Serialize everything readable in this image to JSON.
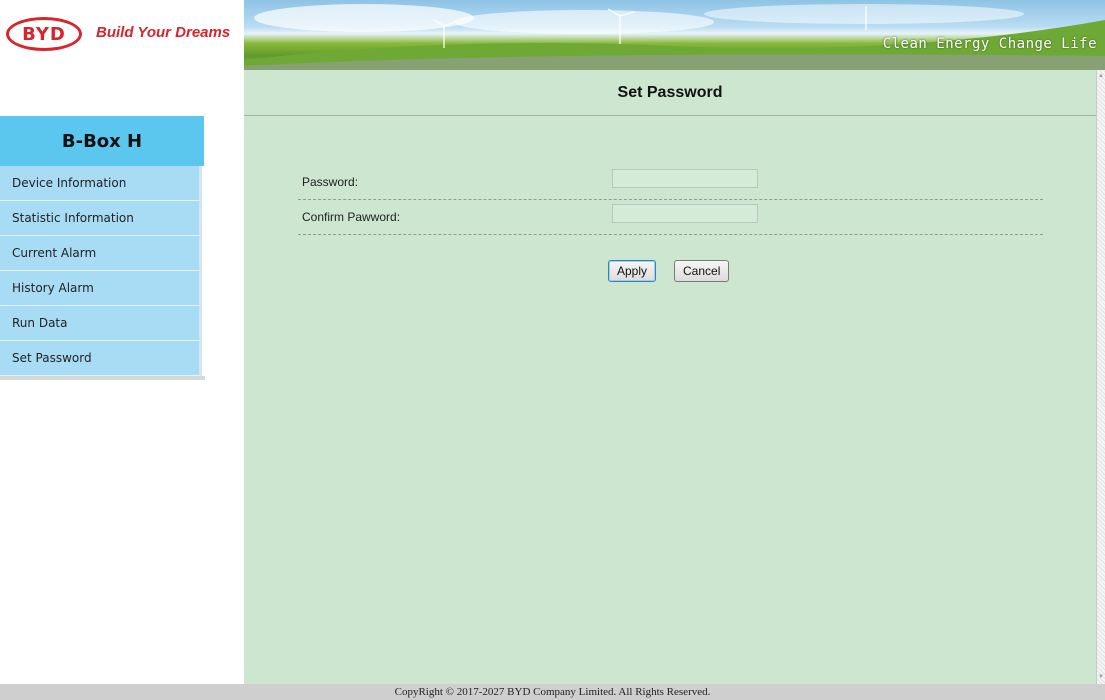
{
  "brand": {
    "logo_text": "BYD",
    "slogan": "Build Your Dreams",
    "banner_slogan": "Clean Energy Change Life",
    "accent_color": "#d9242c"
  },
  "sidebar": {
    "title": "B-Box H",
    "items": [
      {
        "label": "Device Information"
      },
      {
        "label": "Statistic Information"
      },
      {
        "label": "Current Alarm"
      },
      {
        "label": "History Alarm"
      },
      {
        "label": "Run Data"
      },
      {
        "label": "Set Password"
      }
    ]
  },
  "main": {
    "title": "Set Password",
    "form": {
      "password_label": "Password:",
      "password_value": "",
      "confirm_label": "Confirm Pawword:",
      "confirm_value": ""
    },
    "apply_label": "Apply",
    "cancel_label": "Cancel"
  },
  "footer": {
    "copyright": "CopyRight © 2017-2027 BYD Company Limited. All Rights Reserved."
  }
}
